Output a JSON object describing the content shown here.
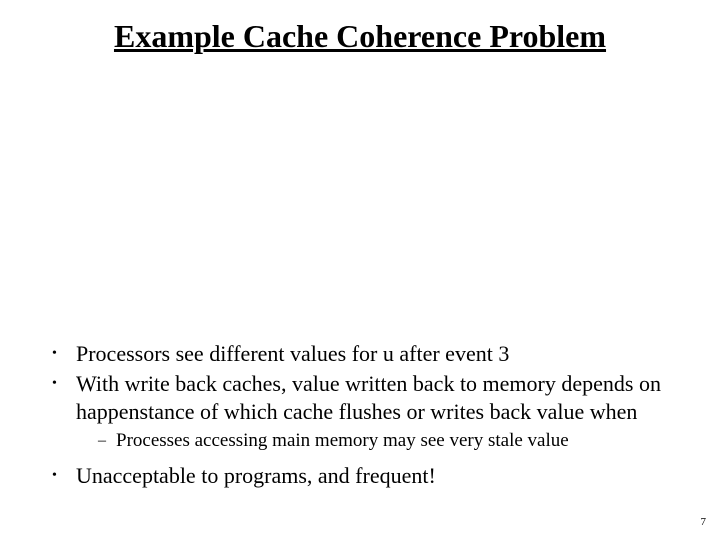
{
  "title": "Example Cache Coherence Problem",
  "bullets": {
    "b1": "Processors see different values for u after event 3",
    "b2": "With write back caches, value written back to memory depends on happenstance of which cache flushes or writes back value when",
    "b2_sub": "Processes accessing main memory may see very stale value",
    "b3": "Unacceptable to programs, and frequent!"
  },
  "page_number": "7"
}
